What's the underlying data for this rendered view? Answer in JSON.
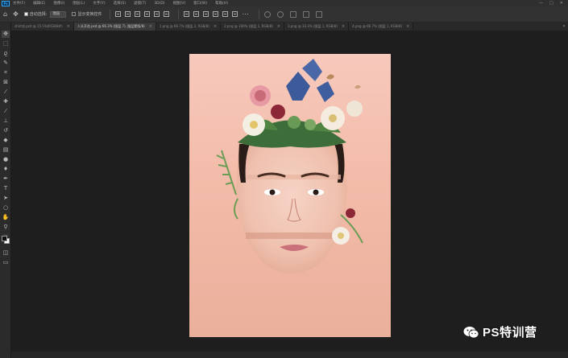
{
  "menu": {
    "app_badge": "Ps",
    "items": [
      "文件(F)",
      "编辑(E)",
      "图像(I)",
      "图层(L)",
      "文字(Y)",
      "选择(S)",
      "滤镜(T)",
      "3D(D)",
      "视图(V)",
      "窗口(W)",
      "帮助(H)"
    ],
    "window_controls": [
      "—",
      "□",
      "✕"
    ]
  },
  "options": {
    "auto_select_label": "自动选择:",
    "auto_select_checked": true,
    "auto_select_value": "图层",
    "show_transform_label": "显示变换控件",
    "show_transform_checked": false
  },
  "tabs": [
    {
      "title": "shirt衣.psd @ 15.5%(RGB/8#)",
      "active": false
    },
    {
      "title": "人头开花.psd @ 66.3% (图层 7), 图层蒙版/8)",
      "active": true
    },
    {
      "title": "1.png @ 66.7% (图层 2, RGB/8)",
      "active": false
    },
    {
      "title": "2.png @ 100% (图层 1, RGB/8)",
      "active": false
    },
    {
      "title": "3.png @ 33.3% (图层 1, RGB/8)",
      "active": false
    },
    {
      "title": "4.png @ 66.7% (图层 1, RGB/8)",
      "active": false
    }
  ],
  "tab_overflow": "»",
  "tools": [
    "move-tool",
    "marquee-tool",
    "lasso-tool",
    "quick-select-tool",
    "crop-tool",
    "frame-tool",
    "eyedropper-tool",
    "healing-brush-tool",
    "brush-tool",
    "clone-stamp-tool",
    "history-brush-tool",
    "eraser-tool",
    "gradient-tool",
    "blur-tool",
    "dodge-tool",
    "pen-tool",
    "type-tool",
    "path-select-tool",
    "shape-tool",
    "hand-tool",
    "zoom-tool",
    "more-tools"
  ],
  "colors": {
    "foreground": "#111111",
    "background": "#ffffff",
    "canvas_top": "#f7c9bc",
    "canvas_bottom": "#ebb09c",
    "workspace": "#1e1e1e"
  },
  "watermark": {
    "icon": "wechat-icon",
    "text": "PS特训营"
  }
}
